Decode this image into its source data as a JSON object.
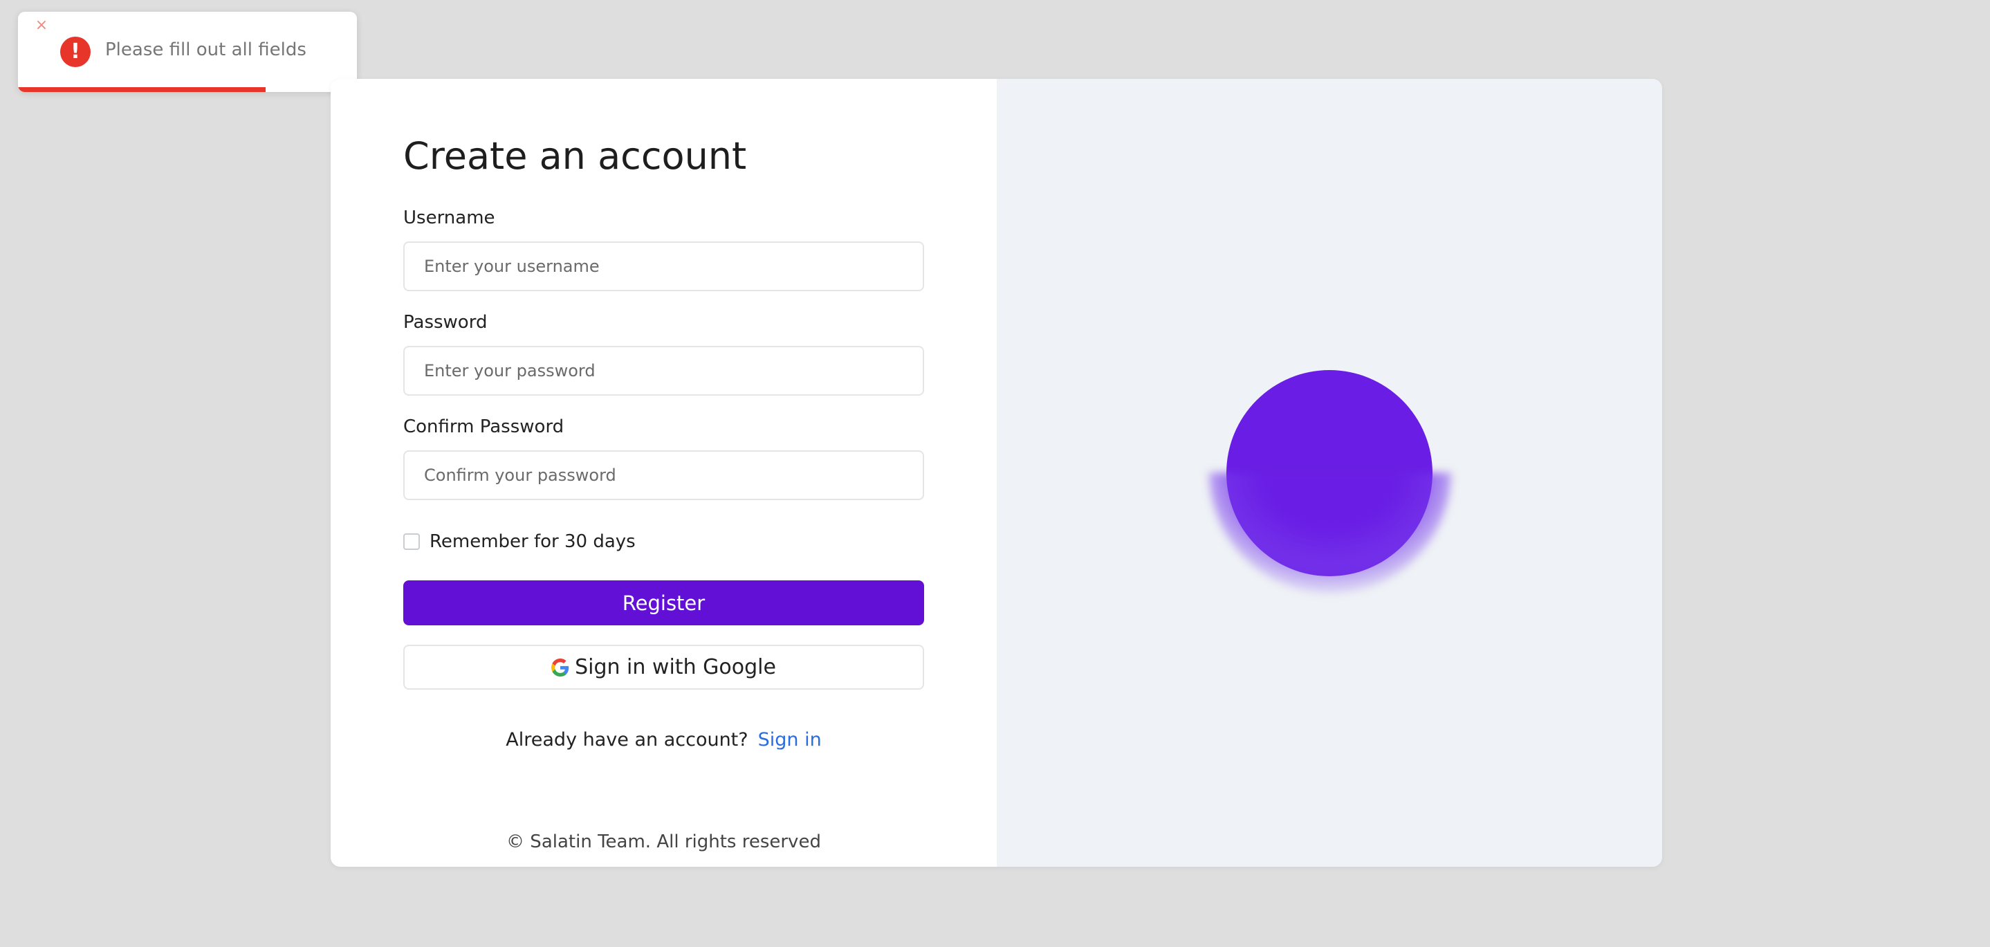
{
  "toast": {
    "close_glyph": "×",
    "icon_glyph": "!",
    "message": "Please fill out all fields",
    "progress_percent": 73,
    "color": "#e7352a"
  },
  "form": {
    "title": "Create an account",
    "username": {
      "label": "Username",
      "placeholder": "Enter your username",
      "value": ""
    },
    "password": {
      "label": "Password",
      "placeholder": "Enter your password",
      "value": ""
    },
    "confirm_password": {
      "label": "Confirm Password",
      "placeholder": "Confirm your password",
      "value": ""
    },
    "remember": {
      "label": "Remember for 30 days",
      "checked": false
    },
    "register_label": "Register",
    "google_label": "Sign in with Google",
    "google_icon": "google-icon",
    "already_text": "Already have an account?",
    "signin_label": "Sign in",
    "footer": "© Salatin Team. All rights reserved"
  },
  "colors": {
    "accent": "#620fd6",
    "link": "#2a6ddf",
    "orb": "#6a1ee5",
    "right_pane_bg": "#eff2f6",
    "page_bg": "#dedede"
  }
}
